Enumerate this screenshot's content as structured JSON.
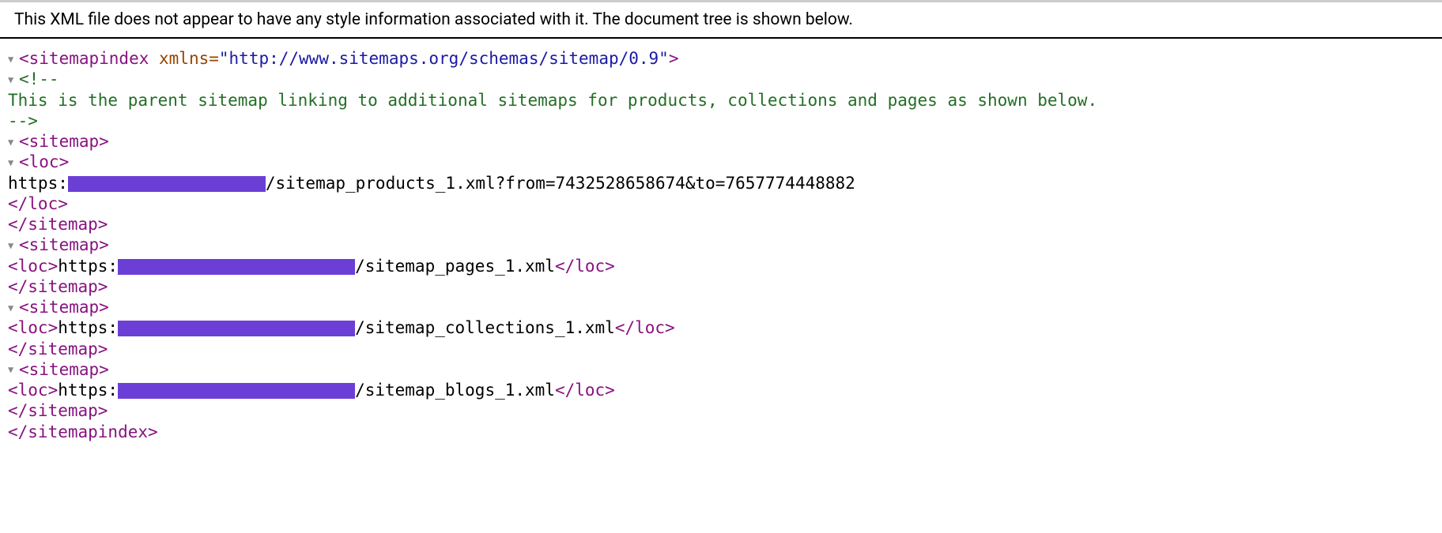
{
  "header": {
    "notice": "This XML file does not appear to have any style information associated with it. The document tree is shown below."
  },
  "xml": {
    "root_open": "<sitemapindex",
    "root_attr_name": " xmlns=",
    "root_attr_value": "\"http://www.sitemaps.org/schemas/sitemap/0.9\"",
    "root_open_end": ">",
    "root_close": "</sitemapindex>",
    "comment_open": "<!--",
    "comment_text": " This is the parent sitemap linking to additional sitemaps for products, collections and pages as shown below. ",
    "comment_close": "-->",
    "sitemap_open": "<sitemap>",
    "sitemap_close": "</sitemap>",
    "loc_open": "<loc>",
    "loc_close": "</loc>",
    "entries": [
      {
        "prefix": "https:",
        "suffix": "/sitemap_products_1.xml?from=7432528658674&to=7657774448882",
        "multiline": true
      },
      {
        "prefix": "https:",
        "suffix": "/sitemap_pages_1.xml",
        "multiline": false
      },
      {
        "prefix": "https:",
        "suffix": "/sitemap_collections_1.xml",
        "multiline": false
      },
      {
        "prefix": "https:",
        "suffix": "/sitemap_blogs_1.xml",
        "multiline": false
      }
    ]
  }
}
